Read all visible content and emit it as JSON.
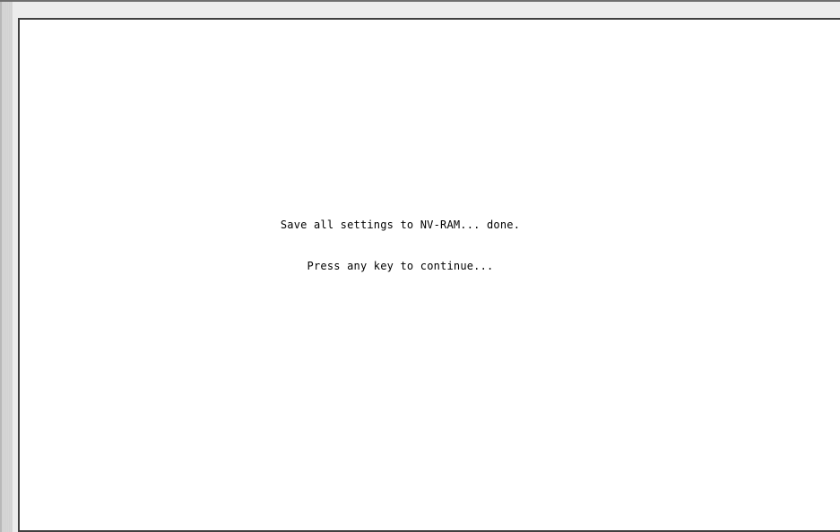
{
  "terminal": {
    "message_line": "Save all settings to NV-RAM... done.",
    "prompt_line": "Press any key to continue..."
  }
}
